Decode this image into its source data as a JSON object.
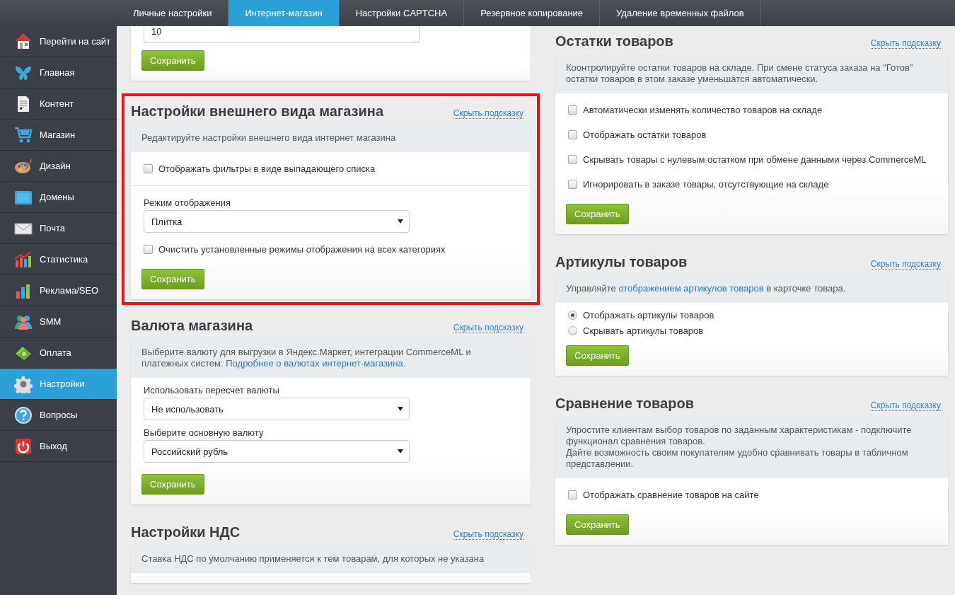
{
  "top_tabs": [
    {
      "label": "Личные настройки",
      "selected": false
    },
    {
      "label": "Интернет-магазин",
      "selected": true
    },
    {
      "label": "Настройки CAPTCHA",
      "selected": false
    },
    {
      "label": "Резервное копирование",
      "selected": false
    },
    {
      "label": "Удаление временных файлов",
      "selected": false
    }
  ],
  "sidebar": {
    "items": [
      {
        "label": "Перейти на сайт",
        "selected": false
      },
      {
        "label": "Главная",
        "selected": false
      },
      {
        "label": "Контент",
        "selected": false
      },
      {
        "label": "Магазин",
        "selected": false
      },
      {
        "label": "Дизайн",
        "selected": false
      },
      {
        "label": "Домены",
        "selected": false
      },
      {
        "label": "Почта",
        "selected": false
      },
      {
        "label": "Статистика",
        "selected": false
      },
      {
        "label": "Реклама/SEO",
        "selected": false
      },
      {
        "label": "SMM",
        "selected": false
      },
      {
        "label": "Оплата",
        "selected": false
      },
      {
        "label": "Настройки",
        "selected": true
      },
      {
        "label": "Вопросы",
        "selected": false
      },
      {
        "label": "Выход",
        "selected": false
      }
    ]
  },
  "left_column": [
    {
      "highlighted": false,
      "groups": [
        {
          "items": [
            {
              "kind": "input",
              "value": "10"
            }
          ]
        }
      ],
      "button": "Сохранить"
    },
    {
      "highlighted": true,
      "title": "Настройки внешнего вида магазина",
      "hide_link": "Скрыть подсказку",
      "hint": [
        {
          "parts": [
            {
              "kind": "text",
              "text": "Редактируйте настройки внешнего вида интернет магазина"
            }
          ]
        }
      ],
      "groups": [
        {
          "items": [
            {
              "kind": "checkbox",
              "label": "Отображать фильтры в виде выпадающего списка",
              "checked": false
            }
          ]
        },
        {
          "items": [
            {
              "kind": "select",
              "label": "Режим отображения",
              "value": "Плитка"
            },
            {
              "kind": "checkbox",
              "label": "Очистить установленные режимы отображения на всех категориях",
              "checked": false
            }
          ]
        }
      ],
      "button": "Сохранить"
    },
    {
      "highlighted": false,
      "title": "Валюта магазина",
      "hide_link": "Скрыть подсказку",
      "hint": [
        {
          "parts": [
            {
              "kind": "text",
              "text": "Выберите валюту для выгрузки в Яндекс.Маркет, интеграции CommerceML и платежных систем. "
            },
            {
              "kind": "link",
              "text": "Подробнее о валютах интернет-магазина."
            }
          ]
        }
      ],
      "groups": [
        {
          "items": [
            {
              "kind": "select",
              "label": "Использовать пересчет валюты",
              "value": "Не использовать"
            },
            {
              "kind": "select",
              "label": "Выберите основную валюту",
              "value": "Российский рубль"
            }
          ]
        }
      ],
      "button": "Сохранить"
    },
    {
      "highlighted": false,
      "title": "Настройки НДС",
      "hide_link": "Скрыть подсказку",
      "hint": [
        {
          "parts": [
            {
              "kind": "text",
              "text": "Ставка НДС по умолчанию применяется к тем товарам, для которых не указана"
            }
          ]
        }
      ]
    }
  ],
  "right_column": [
    {
      "highlighted": false,
      "title": "Остатки товаров",
      "hide_link": "Скрыть подсказку",
      "hint": [
        {
          "parts": [
            {
              "kind": "text",
              "text": "Коонтролируйте остатки товаров на складе. При смене статуса заказа на \"Готов\" остатки товаров в этом заказе уменьшатся автоматически."
            }
          ]
        }
      ],
      "groups": [
        {
          "items": [
            {
              "kind": "checkbox",
              "label": "Автоматически изменять количество товаров на складе",
              "checked": false
            },
            {
              "kind": "checkbox",
              "label": "Отображать остатки товаров",
              "checked": false
            },
            {
              "kind": "checkbox",
              "label": "Скрывать товары с нулевым остатком при обмене данными через CommerceML",
              "checked": false
            },
            {
              "kind": "checkbox",
              "label": "Игнорировать в заказе товары, отсутствующие на складе",
              "checked": false
            }
          ]
        }
      ],
      "button": "Сохранить"
    },
    {
      "highlighted": false,
      "title": "Артикулы товаров",
      "hide_link": "Скрыть подсказку",
      "hint": [
        {
          "parts": [
            {
              "kind": "text",
              "text": "Управляйте "
            },
            {
              "kind": "link",
              "text": "отображением артикулов товаров"
            },
            {
              "kind": "text",
              "text": " в карточке товара."
            }
          ]
        }
      ],
      "groups": [
        {
          "items": [
            {
              "kind": "radio",
              "label": "Отображать артикулы товаров",
              "selected": true
            },
            {
              "kind": "radio",
              "label": "Скрывать артикулы товаров",
              "selected": false
            }
          ]
        }
      ],
      "button": "Сохранить"
    },
    {
      "highlighted": false,
      "title": "Сравнение товаров",
      "hide_link": "Скрыть подсказку",
      "hint": [
        {
          "parts": [
            {
              "kind": "text",
              "text": "Упростите клиентам выбор товаров по заданным характеристикам - подключите функционал сравнения товаров."
            }
          ]
        },
        {
          "parts": [
            {
              "kind": "text",
              "text": "Дайте возможность своим покупателям удобно сравнивать товары в табличном представлении."
            }
          ]
        }
      ],
      "groups": [
        {
          "items": [
            {
              "kind": "checkbox",
              "label": "Отображать сравнение товаров на сайте",
              "checked": false
            }
          ]
        }
      ],
      "button": "Сохранить"
    }
  ]
}
